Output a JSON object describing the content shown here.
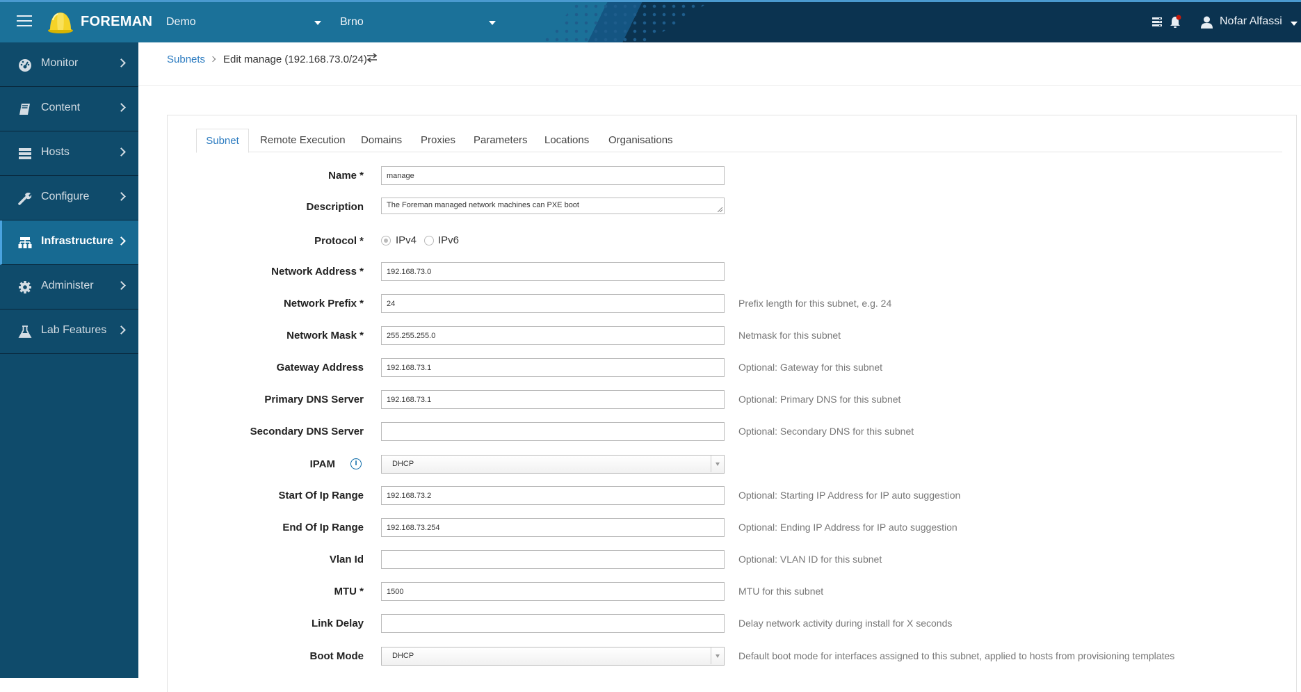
{
  "header": {
    "brand": "FOREMAN",
    "organization": "Demo",
    "location": "Brno",
    "user_name": "Nofar Alfassi",
    "icons": [
      "hamburger-menu-icon",
      "foreman-helmet-logo",
      "task-list-icon",
      "notification-bell-icon",
      "user-icon"
    ],
    "notification_badge_color": "#c9190b"
  },
  "sidebar": {
    "items": [
      {
        "label": "Monitor",
        "icon": "dashboard-gauge-icon",
        "active": false
      },
      {
        "label": "Content",
        "icon": "book-icon",
        "active": false
      },
      {
        "label": "Hosts",
        "icon": "server-icon",
        "active": false
      },
      {
        "label": "Configure",
        "icon": "wrench-icon",
        "active": false
      },
      {
        "label": "Infrastructure",
        "icon": "network-sitemap-icon",
        "active": true
      },
      {
        "label": "Administer",
        "icon": "gear-icon",
        "active": false
      },
      {
        "label": "Lab Features",
        "icon": "flask-icon",
        "active": false
      }
    ]
  },
  "breadcrumb": {
    "parent": "Subnets",
    "current": "Edit manage (192.168.73.0/24)"
  },
  "tabs": [
    {
      "label": "Subnet",
      "active": true
    },
    {
      "label": "Remote Execution",
      "active": false
    },
    {
      "label": "Domains",
      "active": false
    },
    {
      "label": "Proxies",
      "active": false
    },
    {
      "label": "Parameters",
      "active": false
    },
    {
      "label": "Locations",
      "active": false
    },
    {
      "label": "Organisations",
      "active": false
    }
  ],
  "form": {
    "name": {
      "label": "Name *",
      "value": "manage"
    },
    "description": {
      "label": "Description",
      "value": "The Foreman managed network machines can PXE boot"
    },
    "protocol": {
      "label": "Protocol *",
      "options": [
        "IPv4",
        "IPv6"
      ],
      "selected": "IPv4"
    },
    "network_address": {
      "label": "Network Address *",
      "value": "192.168.73.0"
    },
    "network_prefix": {
      "label": "Network Prefix *",
      "value": "24",
      "help": "Prefix length for this subnet, e.g. 24"
    },
    "network_mask": {
      "label": "Network Mask *",
      "value": "255.255.255.0",
      "help": "Netmask for this subnet"
    },
    "gateway": {
      "label": "Gateway Address",
      "value": "192.168.73.1",
      "help": "Optional: Gateway for this subnet"
    },
    "primary_dns": {
      "label": "Primary DNS Server",
      "value": "192.168.73.1",
      "help": "Optional: Primary DNS for this subnet"
    },
    "secondary_dns": {
      "label": "Secondary DNS Server",
      "value": "",
      "help": "Optional: Secondary DNS for this subnet"
    },
    "ipam": {
      "label": "IPAM",
      "value": "DHCP",
      "info_glyph": "i"
    },
    "start_ip": {
      "label": "Start Of Ip Range",
      "value": "192.168.73.2",
      "help": "Optional: Starting IP Address for IP auto suggestion"
    },
    "end_ip": {
      "label": "End Of Ip Range",
      "value": "192.168.73.254",
      "help": "Optional: Ending IP Address for IP auto suggestion"
    },
    "vlan_id": {
      "label": "Vlan Id",
      "value": "",
      "help": "Optional: VLAN ID for this subnet"
    },
    "mtu": {
      "label": "MTU *",
      "value": "1500",
      "help": "MTU for this subnet"
    },
    "link_delay": {
      "label": "Link Delay",
      "value": "",
      "help": "Delay network activity during install for X seconds"
    },
    "boot_mode": {
      "label": "Boot Mode",
      "value": "DHCP",
      "help": "Default boot mode for interfaces assigned to this subnet, applied to hosts from provisioning templates"
    }
  }
}
